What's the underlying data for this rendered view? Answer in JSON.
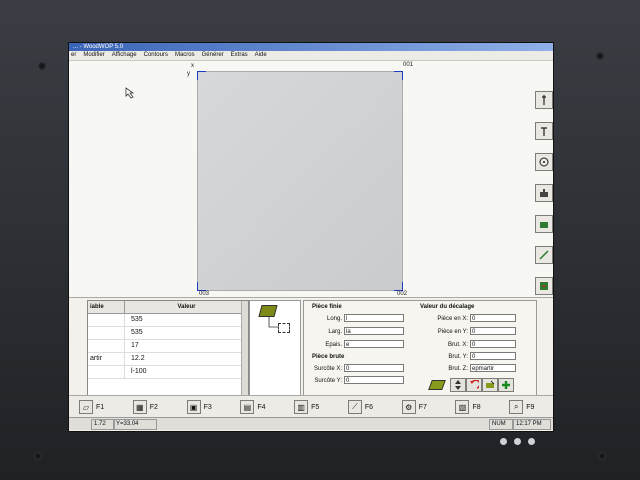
{
  "window": {
    "title": "... - WoodWOP 5.0"
  },
  "menu": [
    "er",
    "Modifier",
    "Affichage",
    "Contours",
    "Macros",
    "Générer",
    "Extras",
    "Aide"
  ],
  "canvas": {
    "top_label": "001",
    "bottom_left_label": "003",
    "bottom_right_label": "002",
    "x_axis": "x",
    "y_axis": "y"
  },
  "table": {
    "headers": [
      "iable",
      "Valeur"
    ],
    "rows": [
      {
        "var": "",
        "val": "535"
      },
      {
        "var": "",
        "val": "535"
      },
      {
        "var": "",
        "val": "17"
      },
      {
        "var": "artir",
        "val": "12.2"
      },
      {
        "var": "",
        "val": "l-100"
      }
    ]
  },
  "piece_finie": {
    "title": "Pièce finie",
    "long_label": "Long.",
    "long_value": "l",
    "larg_label": "Larg.",
    "larg_value": "la",
    "epais_label": "Epais.",
    "epais_value": "e"
  },
  "piece_brute": {
    "title": "Pièce brute",
    "surcote_x_label": "Surcôte X:",
    "surcote_x_value": "0",
    "surcote_y_label": "Surcôte Y:",
    "surcote_y_value": "0"
  },
  "decalage": {
    "title": "Valeur du décalage",
    "piece_x_label": "Pièce en X:",
    "piece_x_value": "0",
    "piece_y_label": "Pièce en Y:",
    "piece_y_value": "0",
    "brut_x_label": "Brut. X:",
    "brut_x_value": "0",
    "brut_y_label": "Brut. Y:",
    "brut_y_value": "0",
    "brut_z_label": "Brut. Z:",
    "brut_z_value": "epmartir"
  },
  "fkeys": [
    "F1",
    "F2",
    "F3",
    "F4",
    "F5",
    "F6",
    "F7",
    "F8",
    "F9"
  ],
  "status": {
    "coord_x": "1.72",
    "coord_y": "Y=33.04",
    "num": "NUM",
    "time": "12:17 PM"
  }
}
